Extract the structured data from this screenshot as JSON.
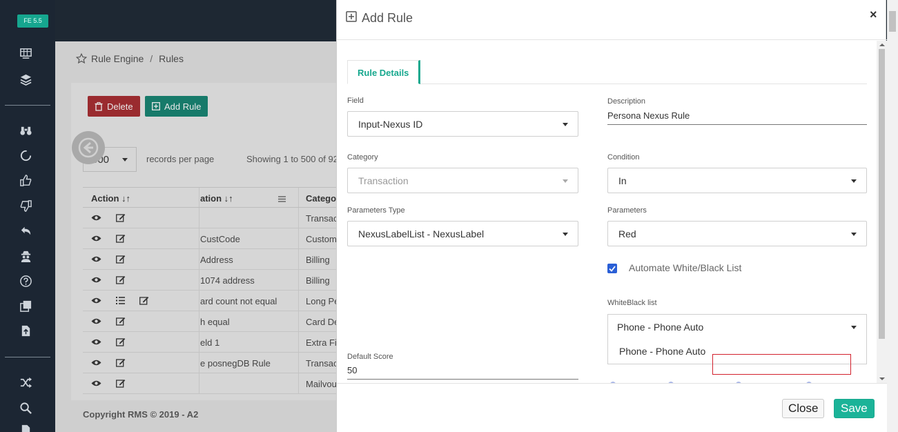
{
  "app": {
    "version_badge": "FE 5.5"
  },
  "breadcrumb": {
    "root": "Rule Engine",
    "sep": "/",
    "current": "Rules"
  },
  "toolbar": {
    "delete_label": "Delete",
    "add_rule_label": "Add Rule"
  },
  "paging": {
    "per_page": "500",
    "per_page_label": "records per page",
    "showing": "Showing 1 to 500 of 92"
  },
  "table": {
    "headers": {
      "action": "Action ↓↑",
      "description": "ation ↓↑",
      "category": "Categor"
    },
    "rows": [
      {
        "desc": "",
        "cat": "Transac"
      },
      {
        "desc": "CustCode",
        "cat": "Custom"
      },
      {
        "desc": "Address",
        "cat": "Billing"
      },
      {
        "desc": "1074 address",
        "cat": "Billing"
      },
      {
        "desc": "ard count not equal",
        "cat": "Long Pe"
      },
      {
        "desc": "h equal",
        "cat": "Card De"
      },
      {
        "desc": "eld 1",
        "cat": "Extra Fi"
      },
      {
        "desc": "e posnegDB Rule",
        "cat": "Transac"
      },
      {
        "desc": "",
        "cat": "Mailvou"
      }
    ]
  },
  "footer": {
    "copyright": "Copyright RMS © 2019 - A2"
  },
  "modal": {
    "title": "Add Rule",
    "close_x": "×",
    "tab_label": "Rule Details",
    "field": {
      "label": "Field",
      "value": "Input-Nexus ID"
    },
    "description": {
      "label": "Description",
      "value": "Persona Nexus Rule"
    },
    "category": {
      "label": "Category",
      "value": "Transaction"
    },
    "condition": {
      "label": "Condition",
      "value": "In"
    },
    "parameters_type": {
      "label": "Parameters Type",
      "value": "NexusLabelList - NexusLabel"
    },
    "parameters": {
      "label": "Parameters",
      "value": "Red"
    },
    "automate": {
      "label": "Automate White/Black List",
      "checked": true
    },
    "whiteblack": {
      "label": "WhiteBlack list",
      "value": "Phone - Phone Auto",
      "options": [
        "Phone - Phone Auto"
      ]
    },
    "default_score": {
      "label": "Default Score",
      "value": "50"
    },
    "close_button": "Close",
    "save_button": "Save"
  },
  "colors": {
    "accent": "#1bb398",
    "danger": "#d2202c",
    "checkbox": "#2a5fd6",
    "sidebar": "#1c2633"
  }
}
